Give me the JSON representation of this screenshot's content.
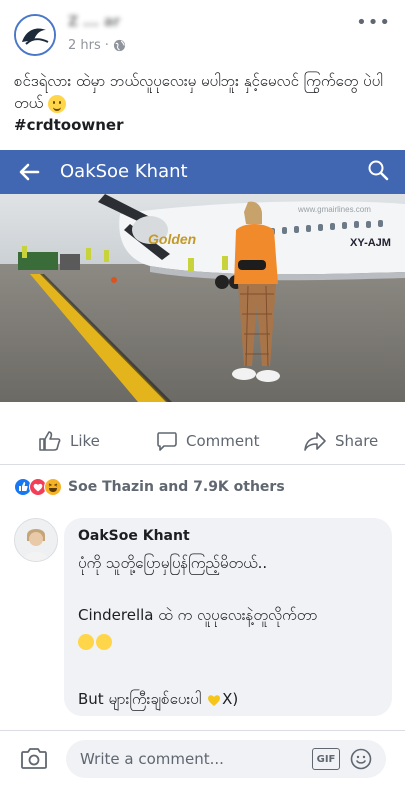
{
  "post": {
    "author": "Z ... ar",
    "time": "2 hrs",
    "separator": "·",
    "text": "စင်ဒရဲလား ထဲမှာ ဘယ်လူပုလေးမှ မပါဘူး နှင့်မေလင် ကြွက်တွေ ပဲပါတယ်",
    "hashtag": "#crdtoowner"
  },
  "shared": {
    "header_title": "OakSoe Khant",
    "photo_registration": "XY-AJM",
    "photo_watermark": "www.gmairlines.com",
    "airline_logo": "Golden"
  },
  "actions": {
    "like": "Like",
    "comment": "Comment",
    "share": "Share"
  },
  "reactions": {
    "summary": "Soe Thazin and 7.9K others"
  },
  "comment": {
    "author": "OakSoe Khant",
    "line1": "ပုံကို သူတို့ပြောမှပြန်ကြည့်မိတယ်..",
    "line2": "Cinderella ထဲ က လူပုလေးနဲ့တူလိုက်တာ",
    "line3": "But များကြီးချစ်ပေးပါ",
    "line3_suffix": "X)"
  },
  "composer": {
    "placeholder": "Write a comment...",
    "gif_label": "GIF"
  },
  "colors": {
    "facebook_blue": "#4267b2",
    "text_secondary": "#606770",
    "bubble_bg": "#f0f2f5"
  }
}
